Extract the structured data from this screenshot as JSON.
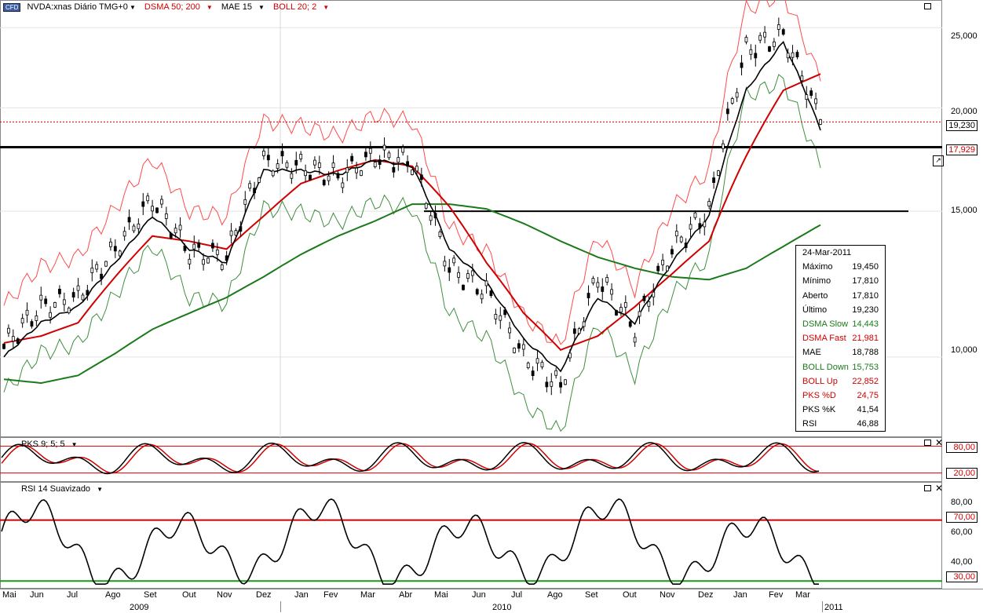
{
  "header": {
    "badge": "CFD",
    "symbol": "NVDA:xnas Diário TMG+0",
    "dsma": "DSMA 50; 200",
    "mae": "MAE 15",
    "boll": "BOLL 20; 2"
  },
  "price_axis": {
    "ticks": [
      "25,000",
      "20,000",
      "15,000",
      "10,000"
    ],
    "last_tag": "19,230",
    "mae_tag": "17,929"
  },
  "info_box": {
    "date": "24-Mar-2011",
    "rows": [
      {
        "k": "Máximo",
        "v": "19,450",
        "c": "#000"
      },
      {
        "k": "Mínimo",
        "v": "17,810",
        "c": "#000"
      },
      {
        "k": "Aberto",
        "v": "17,810",
        "c": "#000"
      },
      {
        "k": "Último",
        "v": "19,230",
        "c": "#000"
      },
      {
        "k": "DSMA Slow",
        "v": "14,443",
        "c": "#1a7a1a"
      },
      {
        "k": "DSMA Fast",
        "v": "21,981",
        "c": "#d00000"
      },
      {
        "k": "MAE",
        "v": "18,788",
        "c": "#000"
      },
      {
        "k": "BOLL Down",
        "v": "15,753",
        "c": "#1a7a1a"
      },
      {
        "k": "BOLL Up",
        "v": "22,852",
        "c": "#d00000"
      },
      {
        "k": "PKS %D",
        "v": "24,75",
        "c": "#d00000"
      },
      {
        "k": "PKS %K",
        "v": "41,54",
        "c": "#000"
      },
      {
        "k": "RSI",
        "v": "46,88",
        "c": "#000"
      }
    ]
  },
  "pks_panel": {
    "title": "PKS 9; 5; 5",
    "levels": [
      "80,00",
      "20,00"
    ]
  },
  "rsi_panel": {
    "title": "RSI 14 Suavizado",
    "ticks": [
      "80,00",
      "60,00",
      "40,00"
    ],
    "levels": [
      "70,00",
      "30,00"
    ]
  },
  "time_axis": {
    "months": [
      "Mai",
      "Jun",
      "Jul",
      "Ago",
      "Set",
      "Out",
      "Nov",
      "Dez",
      "Jan",
      "Fev",
      "Mar",
      "Abr",
      "Mai",
      "Jun",
      "Jul",
      "Ago",
      "Set",
      "Out",
      "Nov",
      "Dez",
      "Jan",
      "Fev",
      "Mar"
    ],
    "years": [
      "2009",
      "2010",
      "2011"
    ]
  },
  "colors": {
    "price": "#000000",
    "dsma_fast": "#d00000",
    "dsma_slow": "#1a7a1a",
    "boll_up": "#ff4a4a",
    "boll_down": "#3f8f3f",
    "level_line": "#d00000"
  },
  "chart_data": {
    "type": "line",
    "x": [
      "2009-05",
      "2009-06",
      "2009-07",
      "2009-08",
      "2009-09",
      "2009-10",
      "2009-11",
      "2009-12",
      "2010-01",
      "2010-02",
      "2010-03",
      "2010-04",
      "2010-05",
      "2010-06",
      "2010-07",
      "2010-08",
      "2010-09",
      "2010-10",
      "2010-11",
      "2010-12",
      "2011-01",
      "2011-02",
      "2011-03"
    ],
    "series": [
      {
        "name": "NVDA:xnas",
        "values": [
          10.3,
          11.5,
          11.8,
          13.5,
          15.5,
          13.4,
          13.2,
          17.2,
          17.0,
          16.5,
          17.5,
          17.2,
          12.8,
          12.0,
          10.0,
          9.2,
          12.5,
          10.8,
          13.5,
          15.0,
          23.5,
          24.5,
          19.23
        ]
      },
      {
        "name": "DSMA Fast",
        "values": [
          10.4,
          10.6,
          11.0,
          12.5,
          14.0,
          13.8,
          13.5,
          14.8,
          16.2,
          16.8,
          17.3,
          17.0,
          15.2,
          13.0,
          11.3,
          10.2,
          10.6,
          11.5,
          12.6,
          13.8,
          17.5,
          21.0,
          21.98
        ]
      },
      {
        "name": "DSMA Slow",
        "values": [
          9.4,
          9.3,
          9.5,
          10.1,
          10.8,
          11.3,
          11.8,
          12.5,
          13.3,
          14.0,
          14.6,
          15.3,
          15.3,
          15.1,
          14.5,
          13.8,
          13.2,
          12.8,
          12.5,
          12.4,
          12.8,
          13.6,
          14.44
        ]
      },
      {
        "name": "MAE",
        "values": [
          10.0,
          11.0,
          11.5,
          13.0,
          14.8,
          13.5,
          13.0,
          16.8,
          16.8,
          16.6,
          17.3,
          17.0,
          13.5,
          12.3,
          10.5,
          9.6,
          11.8,
          11.0,
          13.0,
          14.8,
          21.0,
          24.0,
          18.79
        ]
      }
    ],
    "levels": [
      17.929,
      15.0
    ],
    "ylim": [
      8.0,
      27.0
    ],
    "scale": "log",
    "yticks": [
      25,
      20,
      15,
      10
    ]
  }
}
